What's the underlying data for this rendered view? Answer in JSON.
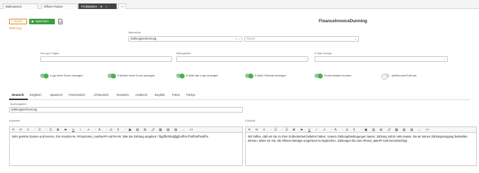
{
  "tabs": [
    {
      "label": "Mahnwesen",
      "active": false
    },
    {
      "label": "Offene Posten",
      "active": false
    },
    {
      "label": "Prüftabellen",
      "active": true
    },
    {
      "label": "",
      "active": false
    }
  ],
  "tab_new_label": "—",
  "toolbar": {
    "back_label": "< Zurück",
    "save_label": "Speichern"
  },
  "page": {
    "title": "FinanceInvoiceDunning",
    "subtitle": "Mahnung"
  },
  "form": {
    "mahnstufe_label": "Mahnstufe",
    "mahnstufe_value": "Zahlungserinnerung",
    "report_placeholder": "Report",
    "verzug_label": "Verzug in Tagen",
    "verzug_value": "",
    "mahngebuehr_label": "Mahngebühr",
    "mahngebuehr_value": "",
    "email_vorlage_label": "E-Mail Vorlage",
    "email_vorlage_value": ""
  },
  "toggles": [
    {
      "label": "Logo beim Druck anzeigen",
      "on": true
    },
    {
      "label": "Fußzeile beim Druck anzeigen",
      "on": true
    },
    {
      "label": "E-Mail das Logo anzeigen",
      "on": true
    },
    {
      "label": "E-Mail Fußzeile anzeigen",
      "on": true
    },
    {
      "label": "Firmendetails drucken",
      "on": true
    },
    {
      "label": "addVoucherToEmail",
      "on": false
    }
  ],
  "languages": [
    "Deutsch",
    "Englisch",
    "Spanisch",
    "Französisch",
    "Chinesisch",
    "Russisch",
    "Arabisch",
    "English",
    "Polen",
    "Türkçe"
  ],
  "buchungstext": {
    "label": "Buchungstext",
    "value": "Zahlungserinnerung"
  },
  "kopfzeile": {
    "label": "Kopfzeile",
    "text": "Sehr geehrte Damen und Herren, Ihre Kunden-Nr. ##customer_number## und Re-Nr. bitte bei Zahlung angeben ! fdgdfhdnhdgfjgfjnnfhm fhmfhmfhmkfhn"
  },
  "fusszeile": {
    "label": "Fußzeile",
    "text": "Wir hoffen, daß wir Sie zu Ihrer Zufriedenheit beliefert haben. Unsere Zahlungsbedingungen lauten: Zahlung sofort netto Kasse. Da wir keinen Zahlungseingang feststellen können, bitten wir Sie, die offenen Beträge umgehend zu begleichen. Zahlungen bis zum ##next_date## sind berücksichtigt."
  },
  "editor_toolbar_items": [
    "⟲",
    "⟳",
    "≡",
    "•",
    "☰",
    "•",
    "☰",
    "B",
    "S",
    "U",
    "I",
    "A",
    "•",
    "Ꭺ",
    "•",
    "⊘",
    "¶",
    "•",
    "▣",
    "▤",
    "⊞",
    "🔗",
    "▦",
    "▧",
    "▨",
    "⇔",
    "<>"
  ]
}
